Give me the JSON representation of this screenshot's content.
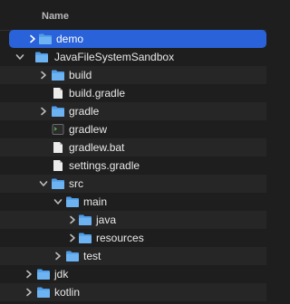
{
  "header": {
    "name_label": "Name"
  },
  "colors": {
    "selection": "#2962d9",
    "folder": "#5aa7ea",
    "file": "#e9e9e9",
    "background": "#1e1e1e"
  },
  "tree": [
    {
      "label": "demo",
      "icon": "folder-icon",
      "expanded": false,
      "selected": true
    },
    {
      "label": "JavaFileSystemSandbox",
      "icon": "folder-icon",
      "expanded": true
    },
    {
      "label": "build",
      "icon": "folder-icon",
      "expanded": false
    },
    {
      "label": "build.gradle",
      "icon": "document-icon"
    },
    {
      "label": "gradle",
      "icon": "folder-icon",
      "expanded": false
    },
    {
      "label": "gradlew",
      "icon": "terminal-executable-icon"
    },
    {
      "label": "gradlew.bat",
      "icon": "document-icon"
    },
    {
      "label": "settings.gradle",
      "icon": "document-icon"
    },
    {
      "label": "src",
      "icon": "folder-icon",
      "expanded": true
    },
    {
      "label": "main",
      "icon": "folder-icon",
      "expanded": true
    },
    {
      "label": "java",
      "icon": "folder-icon",
      "expanded": false
    },
    {
      "label": "resources",
      "icon": "folder-icon",
      "expanded": false
    },
    {
      "label": "test",
      "icon": "folder-icon",
      "expanded": false
    },
    {
      "label": "jdk",
      "icon": "folder-icon",
      "expanded": false
    },
    {
      "label": "kotlin",
      "icon": "folder-icon",
      "expanded": false
    }
  ]
}
